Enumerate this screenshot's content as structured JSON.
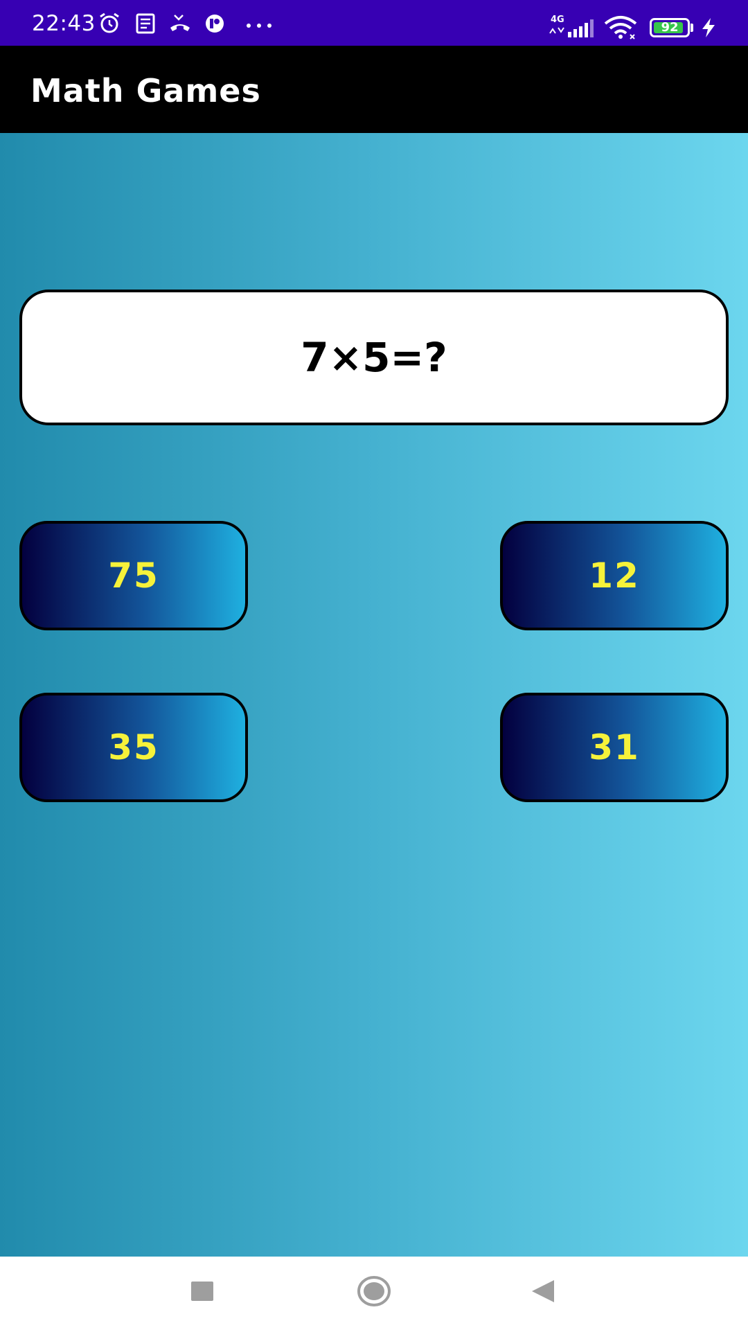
{
  "status_bar": {
    "time": "22:43",
    "network": "4G",
    "battery_level": "92",
    "battery_fraction": 0.92,
    "background_color": "#3700b3",
    "icons": [
      "alarm-icon",
      "news-icon",
      "missed-call-icon",
      "app-notification-icon",
      "more-dots-icon",
      "signal-icon",
      "wifi-icon",
      "battery-icon",
      "charging-icon"
    ]
  },
  "app_bar": {
    "title": "Math Games"
  },
  "question": {
    "text": "7×5=?"
  },
  "answers": [
    {
      "label": "75"
    },
    {
      "label": "12"
    },
    {
      "label": "35"
    },
    {
      "label": "31"
    }
  ],
  "colors": {
    "answer_text": "#f6f23a",
    "main_gradient_start": "#218bac",
    "main_gradient_end": "#6cd6ee",
    "button_gradient_start": "#03003f",
    "button_gradient_end": "#1fb0e0"
  },
  "nav_bar": {
    "icons": [
      "recent-apps-icon",
      "home-icon",
      "back-icon"
    ]
  }
}
